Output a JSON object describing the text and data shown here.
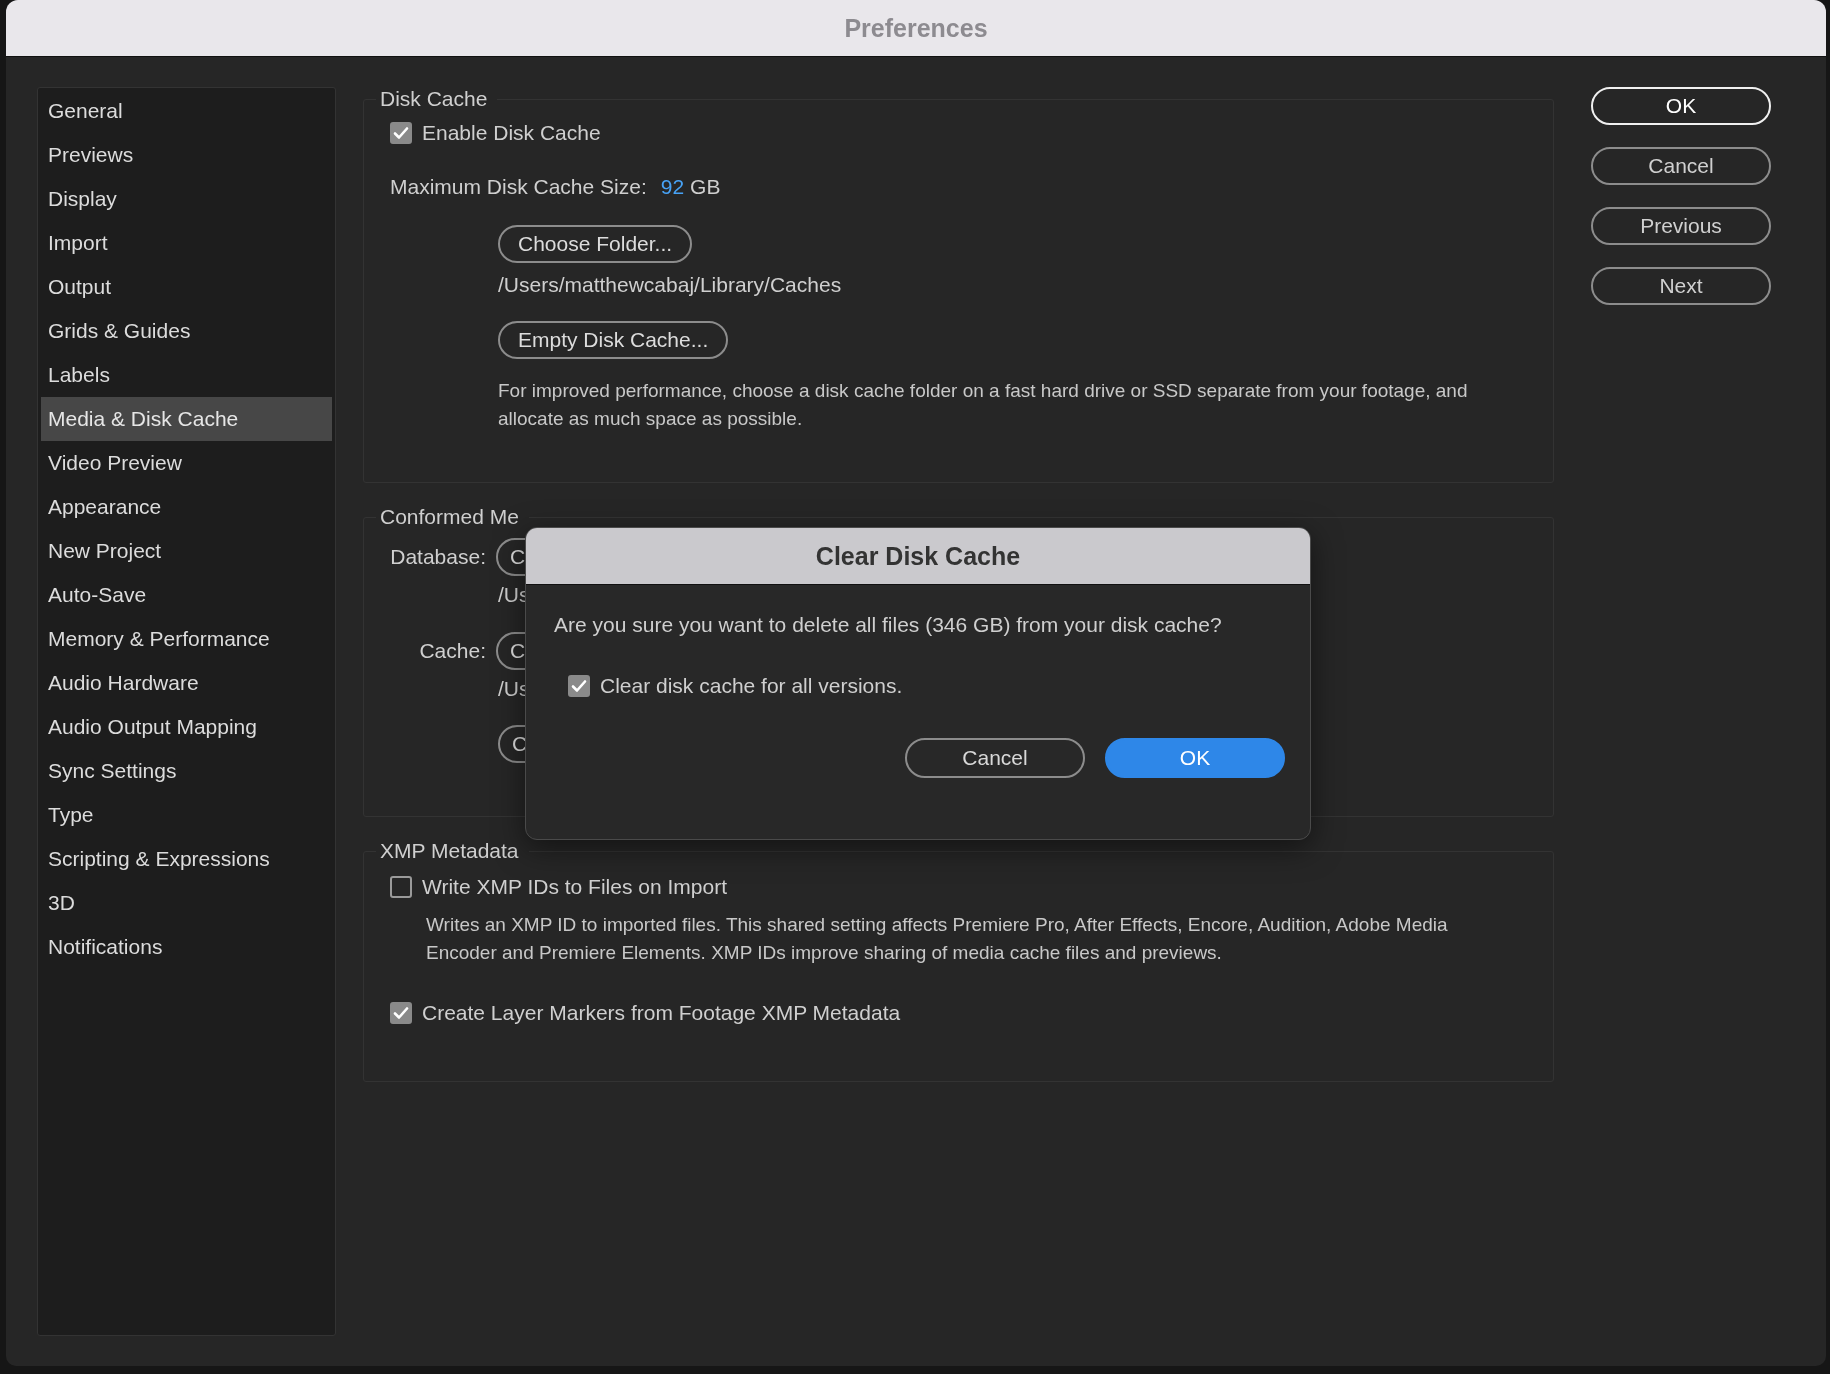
{
  "window": {
    "title": "Preferences"
  },
  "sidebar": {
    "items": [
      {
        "label": "General",
        "selected": false
      },
      {
        "label": "Previews",
        "selected": false
      },
      {
        "label": "Display",
        "selected": false
      },
      {
        "label": "Import",
        "selected": false
      },
      {
        "label": "Output",
        "selected": false
      },
      {
        "label": "Grids & Guides",
        "selected": false
      },
      {
        "label": "Labels",
        "selected": false
      },
      {
        "label": "Media & Disk Cache",
        "selected": true
      },
      {
        "label": "Video Preview",
        "selected": false
      },
      {
        "label": "Appearance",
        "selected": false
      },
      {
        "label": "New Project",
        "selected": false
      },
      {
        "label": "Auto-Save",
        "selected": false
      },
      {
        "label": "Memory & Performance",
        "selected": false
      },
      {
        "label": "Audio Hardware",
        "selected": false
      },
      {
        "label": "Audio Output Mapping",
        "selected": false
      },
      {
        "label": "Sync Settings",
        "selected": false
      },
      {
        "label": "Type",
        "selected": false
      },
      {
        "label": "Scripting & Expressions",
        "selected": false
      },
      {
        "label": "3D",
        "selected": false
      },
      {
        "label": "Notifications",
        "selected": false
      }
    ]
  },
  "disk_cache": {
    "title": "Disk Cache",
    "enable": {
      "label": "Enable Disk Cache",
      "checked": true
    },
    "max_size": {
      "label": "Maximum Disk Cache Size:",
      "value": "92",
      "unit": "GB"
    },
    "choose_folder_button": "Choose Folder...",
    "path": "/Users/matthewcabaj/Library/Caches",
    "empty_button": "Empty Disk Cache...",
    "note": "For improved performance, choose a disk cache folder on a fast hard drive or SSD separate from your footage, and allocate as much space as possible."
  },
  "conformed_media": {
    "title": "Conformed Me",
    "rows": [
      {
        "label": "Database:",
        "button": "C",
        "path": "/Us"
      },
      {
        "label": "Cache:",
        "button": "C",
        "path": "/Us"
      }
    ],
    "extra_button": "C"
  },
  "xmp": {
    "title": "XMP Metadata",
    "options": [
      {
        "label": "Write XMP IDs to Files on Import",
        "checked": false,
        "description": "Writes an XMP ID to imported files. This shared setting affects Premiere Pro, After Effects, Encore, Audition, Adobe Media Encoder and Premiere Elements. XMP IDs improve sharing of media cache files and previews."
      },
      {
        "label": "Create Layer Markers from Footage XMP Metadata",
        "checked": true
      }
    ]
  },
  "buttons": [
    {
      "label": "OK",
      "default": true
    },
    {
      "label": "Cancel",
      "default": false
    },
    {
      "label": "Previous",
      "default": false
    },
    {
      "label": "Next",
      "default": false
    }
  ],
  "dialog": {
    "title": "Clear Disk Cache",
    "message": "Are you sure you want to delete all files (346 GB) from your disk cache?",
    "option": {
      "label": "Clear disk cache for all versions.",
      "checked": true
    },
    "buttons": [
      {
        "label": "Cancel",
        "default": false
      },
      {
        "label": "OK",
        "default": true
      }
    ]
  }
}
